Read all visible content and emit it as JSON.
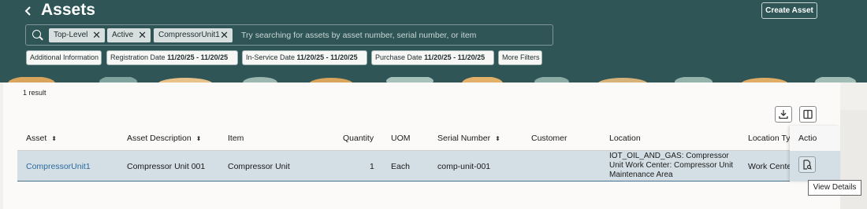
{
  "header": {
    "back_icon": "chevron-left-icon",
    "title": "Assets",
    "create_button": "Create Asset"
  },
  "search": {
    "icon": "search-icon",
    "chips": [
      "Top-Level",
      "Active",
      "CompressorUnit1"
    ],
    "placeholder": "Try searching for assets by asset number, serial number, or item"
  },
  "filters": [
    {
      "label": "Additional Information",
      "value": ""
    },
    {
      "label": "Registration Date",
      "value": "11/20/25 - 11/20/25"
    },
    {
      "label": "In-Service Date",
      "value": "11/20/25 - 11/20/25"
    },
    {
      "label": "Purchase Date",
      "value": "11/20/25 - 11/20/25"
    },
    {
      "label": "More Filters",
      "value": ""
    }
  ],
  "results": {
    "count_text": "1 result",
    "download_icon": "download-icon",
    "columns_icon": "columns-icon"
  },
  "table": {
    "headers": [
      "Asset",
      "Asset Description",
      "Item",
      "Quantity",
      "UOM",
      "Serial Number",
      "Customer",
      "Location",
      "Location Typ",
      "Actio"
    ],
    "rows": [
      {
        "asset": "CompressorUnit1",
        "description": "Compressor Unit 001",
        "item": "Compressor Unit",
        "quantity": "1",
        "uom": "Each",
        "serial": "comp-unit-001",
        "customer": "",
        "location_lines": [
          "IOT_OIL_AND_GAS: Compressor",
          "Unit Work Center: Compressor Unit",
          "Maintenance Area"
        ],
        "location_type": "Work Center",
        "action_icon": "view-details-icon"
      }
    ]
  },
  "tooltip": "View Details",
  "colors": {
    "header_bg": "#2f5556",
    "link": "#2b6aa0",
    "selected_row": "#d4dfe5"
  }
}
